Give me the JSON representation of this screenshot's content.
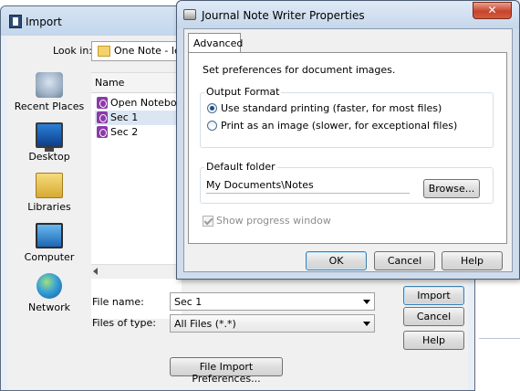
{
  "import_dialog": {
    "title": "Import",
    "look_in_label": "Look in:",
    "look_in_value": "One Note - learn",
    "places": [
      {
        "label": "Recent Places",
        "icon": "recent-places-icon"
      },
      {
        "label": "Desktop",
        "icon": "desktop-icon"
      },
      {
        "label": "Libraries",
        "icon": "libraries-icon"
      },
      {
        "label": "Computer",
        "icon": "computer-icon"
      },
      {
        "label": "Network",
        "icon": "network-icon"
      }
    ],
    "column_name": "Name",
    "files": [
      {
        "name": "Open Notebook"
      },
      {
        "name": "Sec 1"
      },
      {
        "name": "Sec 2"
      }
    ],
    "file_name_label": "File name:",
    "file_name_value": "Sec 1",
    "file_type_label": "Files of type:",
    "file_type_value": "All Files (*.*)",
    "import_button": "Import",
    "cancel_button": "Cancel",
    "help_button": "Help",
    "preferences_button": "File Import Preferences..."
  },
  "properties_dialog": {
    "title": "Journal Note Writer Properties",
    "close_glyph": "✕",
    "tab_label": "Advanced",
    "description": "Set preferences for document images.",
    "output_format_label": "Output Format",
    "option_standard": "Use standard printing (faster, for most files)",
    "option_image": "Print as an image (slower, for exceptional files)",
    "default_folder_label": "Default folder",
    "default_folder_value": "My Documents\\Notes",
    "browse_button": "Browse...",
    "show_progress_label": "Show progress window",
    "ok_button": "OK",
    "cancel_button": "Cancel",
    "help_button": "Help"
  },
  "colors": {
    "titlebar": "#c6d7eb",
    "close_button": "#c7442c",
    "onenote_icon": "#8b3aa8",
    "selected_row": "#dce6f3"
  }
}
